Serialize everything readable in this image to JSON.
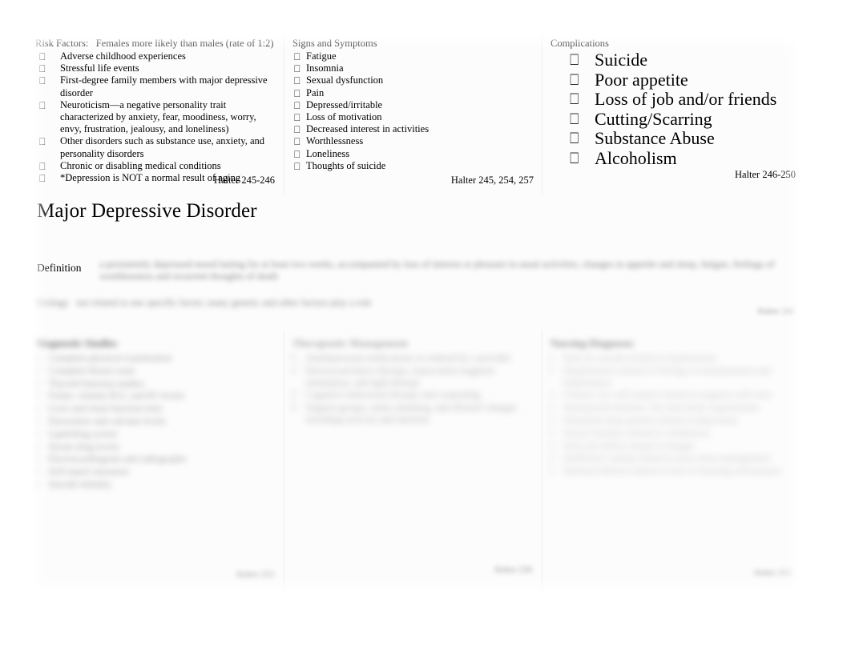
{
  "document": {
    "title": "Major Depressive Disorder",
    "definition_label": "Definition"
  },
  "bullet_glyph": "⎕",
  "top_columns": [
    {
      "heading": "Risk Factors:   Females more likely than males (rate of 1:2)",
      "items": [
        "Adverse childhood experiences",
        "Stressful life events",
        "First-degree family members with major depressive disorder",
        "Neuroticism—a negative personality trait characterized by anxiety, fear, moodiness, worry, envy, frustration, jealousy, and loneliness)",
        "Other disorders such as substance use, anxiety, and personality disorders",
        "Chronic or disabling medical conditions",
        "*Depression is NOT a normal result of aging"
      ],
      "citation": "Halter 245-246"
    },
    {
      "heading": "Signs and Symptoms",
      "items": [
        "Fatigue",
        "Insomnia",
        "Sexual dysfunction",
        "Pain",
        "Depressed/irritable",
        "Loss of motivation",
        "Decreased interest in activities",
        "Worthlessness",
        "Loneliness",
        "Thoughts of suicide"
      ],
      "citation": "Halter 245, 254, 257"
    },
    {
      "heading": "Complications",
      "items": [
        "Suicide",
        "Poor appetite",
        "Loss of job and/or friends",
        "Cutting/Scarring",
        "Substance Abuse",
        "Alcoholism"
      ],
      "citation": "Halter 246-250"
    }
  ],
  "definition_section": {
    "label": "Definition",
    "body_blurred": "a persistently depressed mood lasting for at least two weeks, accompanied by loss of interest or pleasure in usual activities, changes in appetite and sleep, fatigue, feelings of worthlessness and recurrent thoughts of death",
    "etiology_blurred": "Etiology   not related to one specific factor; many genetic and other factors play a role",
    "citation_blurred": "Halter 245"
  },
  "bottom_columns": [
    {
      "heading": "Diagnostic Studies",
      "items": [
        "Complete physical examination",
        "Complete blood count",
        "Thyroid function studies",
        "Folate, vitamin B12, and B1 levels",
        "Liver and renal function tests",
        "Electrolyte and calcium levels",
        "Lipid/drug screen",
        "Serum drug levels",
        "Electrocardiogram and radiographs",
        "Self-report measures",
        "Suicide lethality"
      ],
      "citation": "Halter 253"
    },
    {
      "heading": "Therapeutic Management",
      "items": [
        "Antidepressant medications as ordered by a provider",
        "Electroconvulsive therapy, transcranial magnetic stimulation, and light therapy",
        "Cognitive behavioral therapy and counseling",
        "Support groups, safety planning, and lifestyle changes including exercise and nutrition"
      ],
      "citation": "Halter 258"
    },
    {
      "heading": "Nursing Diagnoses",
      "items": [
        "Risk for suicide related to hopelessness",
        "Hopelessness related to feelings of abandonment and helplessness",
        "Chronic low self-esteem related to negative self-view",
        "Imbalanced nutrition: less than body requirements",
        "Disturbed sleep pattern related to depression",
        "Social isolation related to withdrawal",
        "Self-care deficit related to fatigue",
        "Ineffective coping related to poor stress management",
        "Spiritual distress related to loss of meaning and purpose"
      ],
      "citation": "Halter 255"
    }
  ]
}
